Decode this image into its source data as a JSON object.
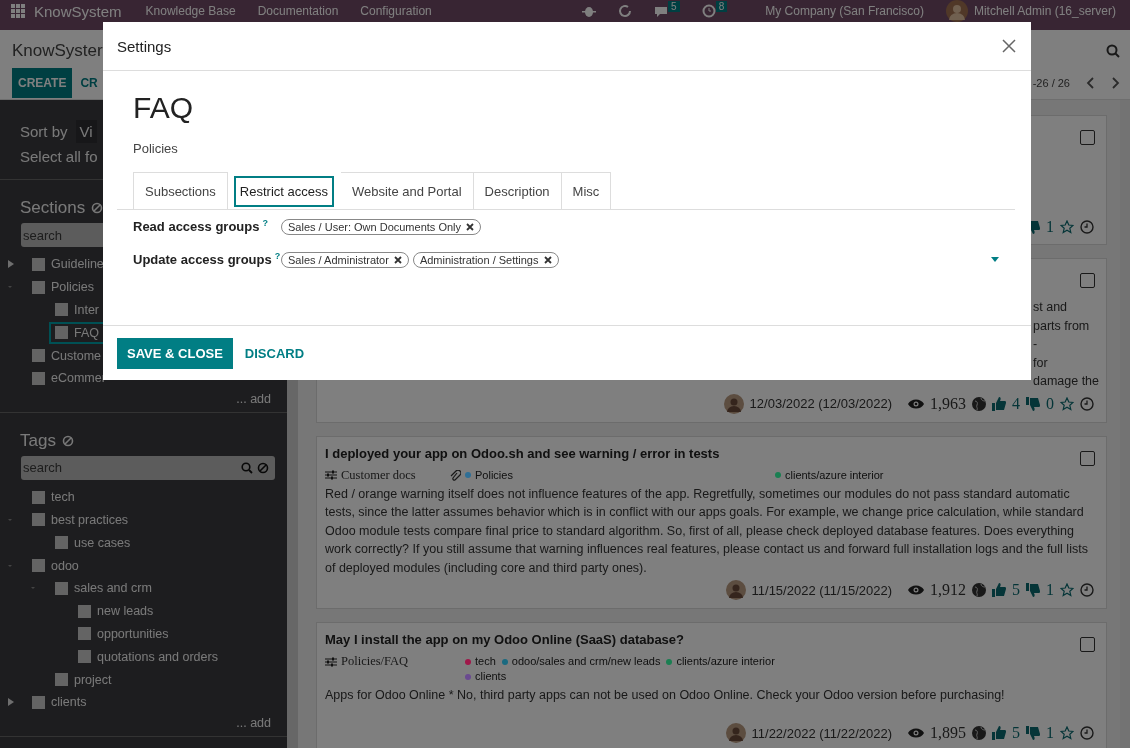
{
  "navbar": {
    "app_name": "KnowSystem",
    "menus": [
      "Knowledge Base",
      "Documentation",
      "Configuration"
    ],
    "messages_badge": "5",
    "activities_badge": "8",
    "company": "My Company (San Francisco)",
    "user": "Mitchell Admin (16_server)"
  },
  "control_panel": {
    "breadcrumb": "KnowSyster",
    "buttons": [
      "CREATE",
      "CR"
    ],
    "pager": "-26 / 26"
  },
  "sidebar": {
    "sort_label": "Sort by",
    "sort_value": "Vi",
    "select_all": "Select all fo",
    "sections": {
      "title": "Sections",
      "placeholder": "search",
      "add": "... add",
      "items": [
        {
          "label": "Guideline",
          "expanded": false,
          "checked": false,
          "selected": false
        },
        {
          "label": "Policies",
          "expanded": true,
          "checked": false,
          "selected": false,
          "children": [
            {
              "label": "Inter",
              "checked": false,
              "selected": false
            },
            {
              "label": "FAQ",
              "checked": false,
              "selected": true
            }
          ]
        },
        {
          "label": "Custome",
          "checked": false,
          "selected": false
        },
        {
          "label": "eCommer",
          "checked": false,
          "selected": false
        }
      ]
    },
    "tags": {
      "title": "Tags",
      "placeholder": "search",
      "add": "... add",
      "items": [
        {
          "label": "tech",
          "checked": false,
          "selected": false
        },
        {
          "label": "best practices",
          "expanded": true,
          "checked": false,
          "selected": false,
          "children": [
            {
              "label": "use cases",
              "checked": false,
              "selected": false
            }
          ]
        },
        {
          "label": "odoo",
          "expanded": true,
          "checked": false,
          "selected": false,
          "children": [
            {
              "label": "sales and crm",
              "expanded": true,
              "checked": false,
              "selected": false,
              "children": [
                {
                  "label": "new leads",
                  "checked": false,
                  "selected": false
                },
                {
                  "label": "opportunities",
                  "checked": false,
                  "selected": false
                },
                {
                  "label": "quotations and orders",
                  "checked": false,
                  "selected": false
                }
              ]
            },
            {
              "label": "project",
              "checked": false,
              "selected": false
            }
          ]
        },
        {
          "label": "clients",
          "expanded": false,
          "checked": false,
          "selected": false
        }
      ]
    }
  },
  "cards": [
    {
      "checked": false,
      "dislikes": "1"
    },
    {
      "checked": false,
      "body_fragments": [
        "st and",
        "parts from",
        "-",
        "for",
        "damage the"
      ],
      "date": "12/03/2022 (12/03/2022)",
      "views": "1,963",
      "likes": "4",
      "dislikes": "0"
    },
    {
      "checked": false,
      "title": "I deployed your app on Odoo.sh and see warning / error in tests",
      "category": "Customer docs",
      "attachment": true,
      "tag_groups": [
        [
          {
            "label": "Policies",
            "color": "#2f6f96"
          }
        ],
        [
          {
            "label": "clients/azure interior",
            "color": "#1a7f52"
          }
        ]
      ],
      "body": "Red / orange warning itself does not influence features of the app. Regretfully, sometimes our modules do not pass standard automatic tests, since the latter assumes behavior which is in conflict with our apps goals. For example, we change price calculation, while standard Odoo module tests compare final price to standard algorithm. So, first of all, please check deployed database features. Does everything work correctly? If you still assume that warning influences real features, please contact us and forward full installation logs and the full lists of deployed modules (including core and third party ones).",
      "date": "11/15/2022 (11/15/2022)",
      "views": "1,912",
      "likes": "5",
      "dislikes": "1"
    },
    {
      "checked": false,
      "title": "May I install the app on my Odoo Online (SaaS) database?",
      "category": "Policies/FAQ",
      "attachment": false,
      "tag_groups": [
        [
          {
            "label": "tech",
            "color": "#a0184a"
          },
          {
            "label": "odoo/sales and crm/new leads",
            "color": "#1a6a80"
          },
          {
            "label": "clients/azure interior",
            "color": "#1a7f52"
          },
          {
            "label": "clients",
            "color": "#6a4a90"
          }
        ]
      ],
      "body": "Apps for Odoo Online * No, third party apps can not be used on Odoo Online. Check your Odoo version before purchasing!",
      "date": "11/22/2022 (11/22/2022)",
      "views": "1,895",
      "likes": "5",
      "dislikes": "1"
    }
  ],
  "modal": {
    "title": "Settings",
    "record_name": "FAQ",
    "parent": "Policies",
    "tabs": [
      {
        "label": "Subsections",
        "selected": false
      },
      {
        "label": "Restrict access",
        "selected": true
      },
      {
        "label": "Website and Portal",
        "selected": false
      },
      {
        "label": "Description",
        "selected": false
      },
      {
        "label": "Misc",
        "selected": false
      }
    ],
    "fields": [
      {
        "label": "Read access groups",
        "help": "?",
        "tags": [
          "Sales / User: Own Documents Only"
        ],
        "dropdown": false
      },
      {
        "label": "Update access groups",
        "help": "?",
        "tags": [
          "Sales / Administrator",
          "Administration / Settings"
        ],
        "dropdown": true
      }
    ],
    "buttons": [
      {
        "label": "SAVE & CLOSE",
        "kind": "primary"
      },
      {
        "label": "DISCARD",
        "kind": "link"
      }
    ]
  }
}
